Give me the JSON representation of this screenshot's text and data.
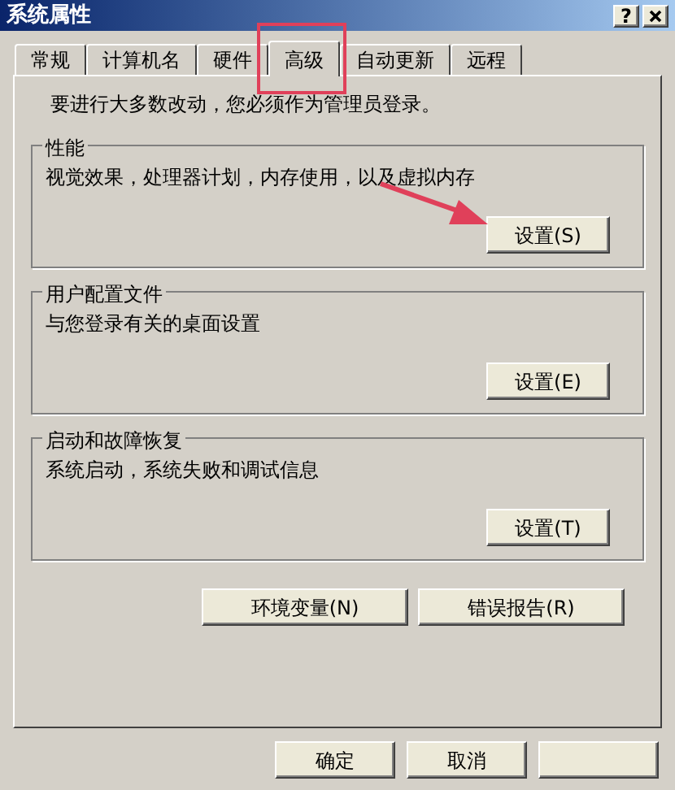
{
  "window": {
    "title": "系统属性",
    "title_buttons": [
      {
        "kind": "help",
        "label": "?"
      },
      {
        "kind": "close"
      }
    ]
  },
  "tabs": [
    {
      "label": "常规",
      "selected": false
    },
    {
      "label": "计算机名",
      "selected": false
    },
    {
      "label": "硬件",
      "selected": false
    },
    {
      "label": "高级",
      "selected": true
    },
    {
      "label": "自动更新",
      "selected": false
    },
    {
      "label": "远程",
      "selected": false
    }
  ],
  "notice": "要进行大多数改动，您必须作为管理员登录。",
  "groups": [
    {
      "title": "性能",
      "description": "视觉效果，处理器计划，内存使用，以及虚拟内存",
      "button": "设置(S)"
    },
    {
      "title": "用户配置文件",
      "description": "与您登录有关的桌面设置",
      "button": "设置(E)"
    },
    {
      "title": "启动和故障恢复",
      "description": "系统启动，系统失败和调试信息",
      "button": "设置(T)"
    }
  ],
  "extra_buttons": [
    "环境变量(N)",
    "错误报告(R)"
  ],
  "dialog_buttons": [
    {
      "kind": "text",
      "label": "确定"
    },
    {
      "kind": "text",
      "label": "取消"
    },
    {
      "kind": "blank"
    }
  ]
}
